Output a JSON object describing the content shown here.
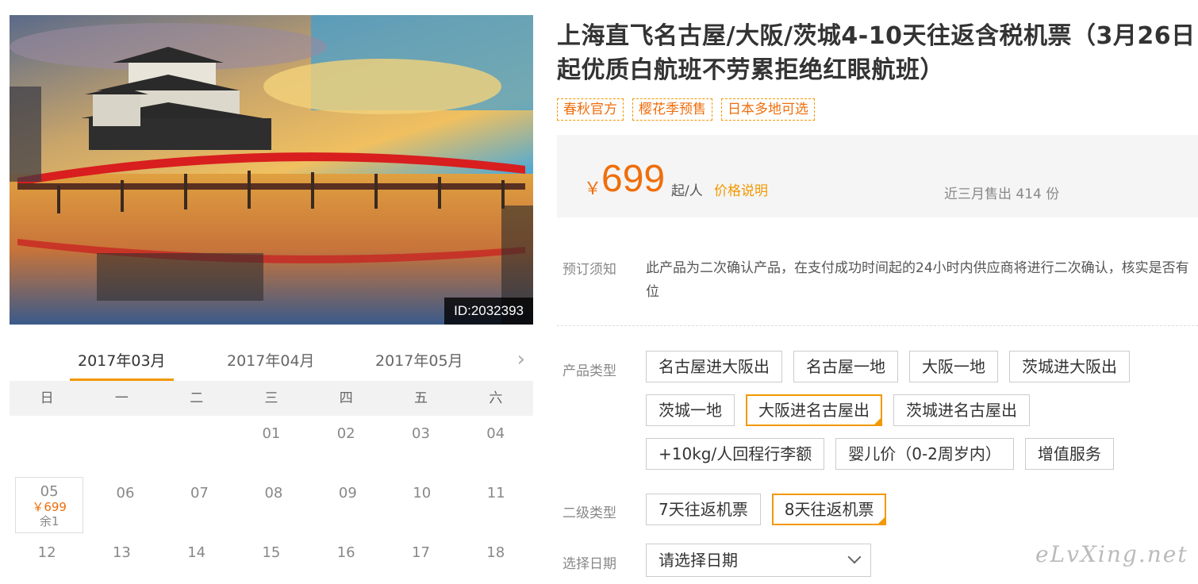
{
  "photo": {
    "id_label": "ID:2032393"
  },
  "calendar": {
    "months": [
      "2017年03月",
      "2017年04月",
      "2017年05月"
    ],
    "weekdays": [
      "日",
      "一",
      "二",
      "三",
      "四",
      "五",
      "六"
    ],
    "row1": [
      "01",
      "02",
      "03",
      "04"
    ],
    "avail_day": {
      "num": "05",
      "price": "￥699",
      "left": "余1"
    },
    "row2": [
      "06",
      "07",
      "08",
      "09",
      "10",
      "11"
    ],
    "row3": [
      "12",
      "13",
      "14",
      "15",
      "16",
      "17",
      "18"
    ]
  },
  "product": {
    "title": "上海直飞名古屋/大阪/茨城4-10天往返含税机票（3月26日起优质白航班不劳累拒绝红眼航班）",
    "tags": [
      "春秋官方",
      "樱花季预售",
      "日本多地可选"
    ],
    "currency": "￥",
    "price": "699",
    "per": "起/人",
    "price_note": "价格说明",
    "sold": "近三月售出 414 份",
    "notice_label": "预订须知",
    "notice_text": "此产品为二次确认产品，在支付成功时间起的24小时内供应商将进行二次确认，核实是否有位",
    "type_label": "产品类型",
    "types": [
      "名古屋进大阪出",
      "名古屋一地",
      "大阪一地",
      "茨城进大阪出",
      "茨城一地",
      "大阪进名古屋出",
      "茨城进名古屋出",
      "+10kg/人回程行李额",
      "婴儿价（0-2周岁内）",
      "增值服务"
    ],
    "selected_type": "大阪进名古屋出",
    "sub_label": "二级类型",
    "subs": [
      "7天往返机票",
      "8天往返机票"
    ],
    "selected_sub": "8天往返机票",
    "date_label": "选择日期",
    "date_placeholder": "请选择日期"
  },
  "watermark": "eLvXing.net",
  "colors": {
    "accent": "#f39800",
    "price": "#ef6e0c"
  }
}
